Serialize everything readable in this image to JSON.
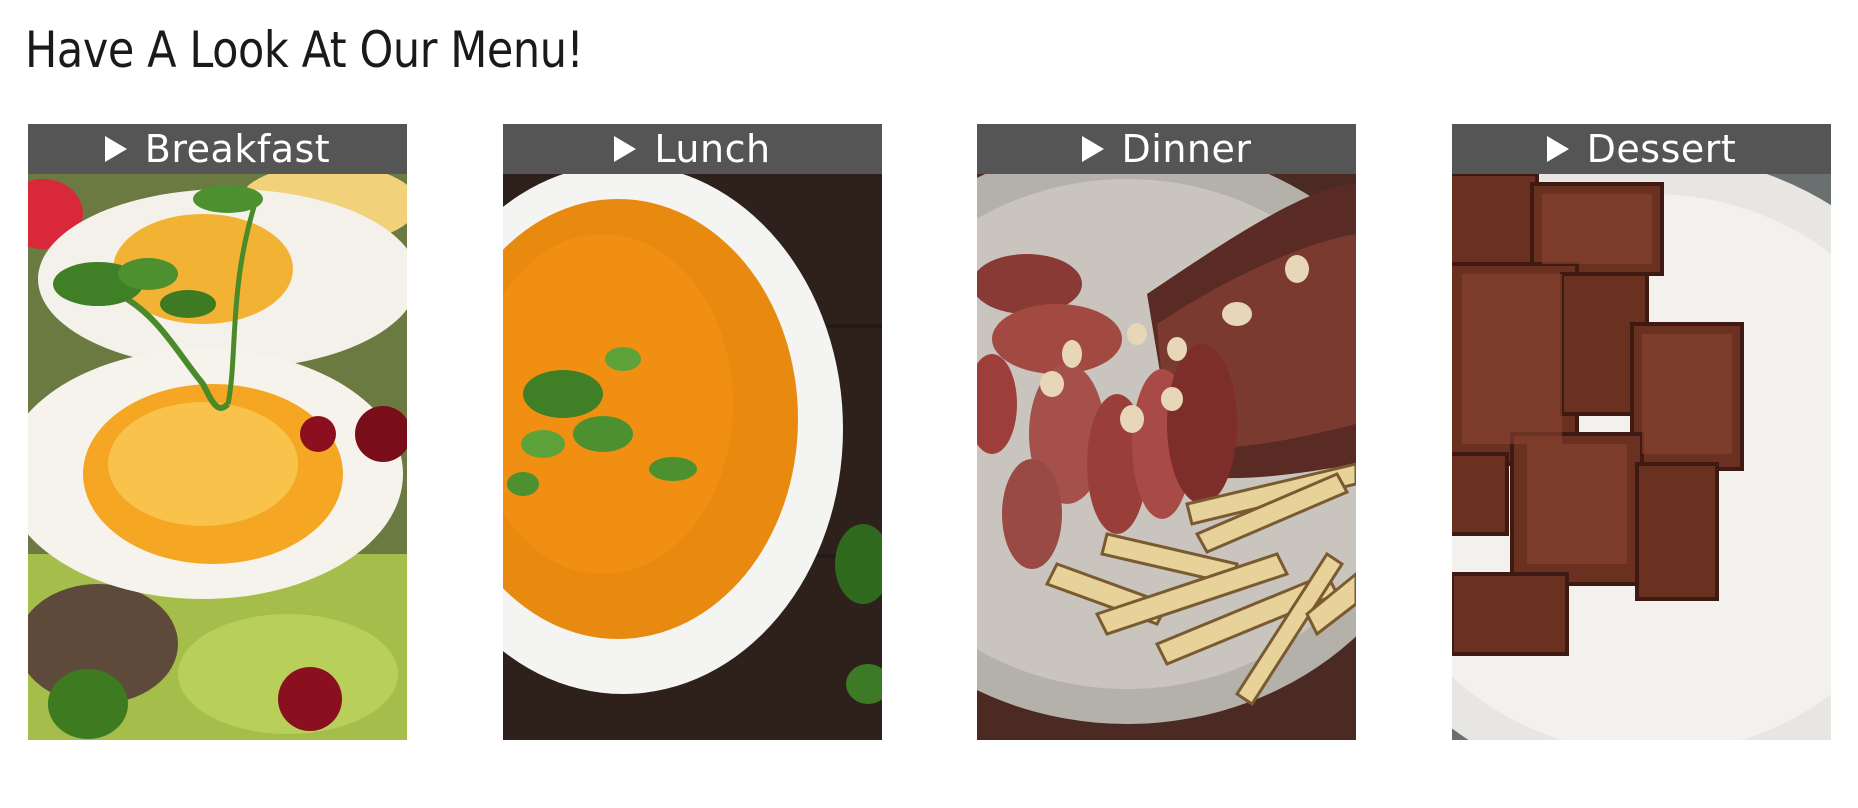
{
  "page": {
    "title": "Have A Look At Our Menu!"
  },
  "menu": [
    {
      "label": "Breakfast",
      "image": "boiled eggs on avocado toast"
    },
    {
      "label": "Lunch",
      "image": "bowl of tomato soup"
    },
    {
      "label": "Dinner",
      "image": "sliced steak with fries"
    },
    {
      "label": "Dessert",
      "image": "plate of brownies"
    }
  ],
  "icons": {
    "toggle": "play-triangle-icon"
  },
  "colors": {
    "header_bg": "#555555",
    "header_text": "#ffffff"
  }
}
